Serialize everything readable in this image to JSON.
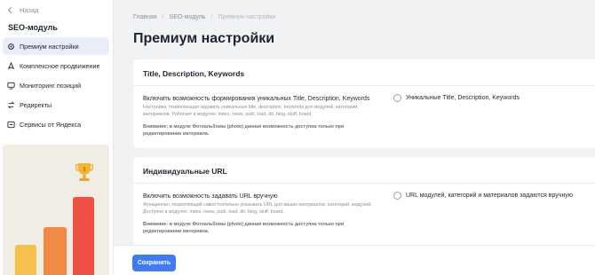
{
  "sidebar": {
    "back_label": "Назад",
    "module_title": "SEO-модуль",
    "items": [
      {
        "label": "Премиум настройки",
        "icon": "gear-icon",
        "active": true
      },
      {
        "label": "Комплексное продвижение",
        "icon": "rocket-icon",
        "active": false
      },
      {
        "label": "Мониторинг позиций",
        "icon": "monitor-icon",
        "active": false
      },
      {
        "label": "Редиректы",
        "icon": "redirect-icon",
        "active": false
      },
      {
        "label": "Сервисы от Яндекса",
        "icon": "services-icon",
        "active": false
      }
    ]
  },
  "breadcrumb": {
    "home": "Главная",
    "module": "SEO-модуль",
    "current": "Премиум настройки"
  },
  "page_title": "Премиум настройки",
  "sections": [
    {
      "header": "Title, Description, Keywords",
      "setting_title": "Включить возможность формирования уникальных Title, Description, Keywords",
      "setting_desc": "Настройка, позволяющая задавать уникальные title, description, keywords для модулей, категорий, материалов. Работает в модулях: index, news, publ, load, dir, blog, stuff, board.",
      "setting_note": "Внимание: в модуле Фотоальбомы (photo) данная возможность доступна только при редактировании материала.",
      "checkbox_label": "Уникальные Title, Description, Keywords",
      "checked": false
    },
    {
      "header": "Индивидуальные URL",
      "setting_title": "Включить возможность задавать URL вручную",
      "setting_desc": "Функционал, позволяющий самостоятельно указывать URL для ваших материалов, категорий, модулей. Доступно в модулях: index, news, publ, load, dir, blog, stuff, board.",
      "setting_note": "Внимание: в модуле Фотоальбомы (photo) данная возможность доступна только при редактировании материала.",
      "checkbox_label": "URL модулей, категорий и материалов задаются вручную",
      "checked": false
    }
  ],
  "footer": {
    "save_label": "Сохранить"
  },
  "colors": {
    "accent": "#3f7cf4",
    "active_nav_bg": "#e8edf8",
    "bar_yellow": "#f7c04a",
    "bar_orange": "#f08a44",
    "bar_red": "#ef5243"
  }
}
